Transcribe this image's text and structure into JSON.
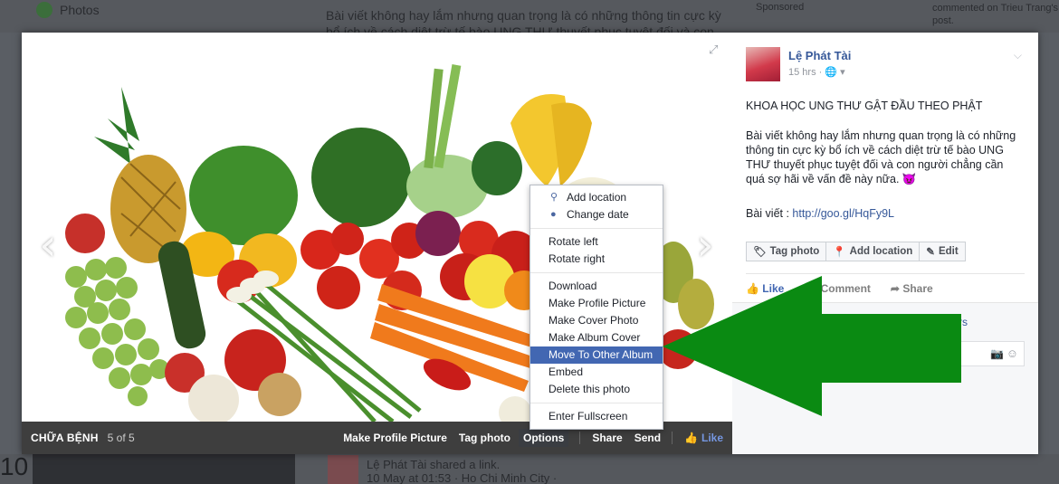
{
  "background": {
    "sidebar_label": "Photos",
    "post_text": "Bài viết không hay lắm nhưng quan trọng là có những thông tin cực kỳ bổ ích về cách diệt trừ tế bào UNG THƯ thuyết phục tuyệt đối và con người",
    "sponsored": "Sponsored",
    "notification": "commented on Trieu Trang's post.",
    "bottom_number": "10",
    "shared_author": "Lệ Phát Tài",
    "shared_action": "shared a link.",
    "shared_meta": "10 May at 01:53 · Ho Chi Minh City ·"
  },
  "photo_bar": {
    "album_title": "CHỮA BỆNH",
    "count": "5 of 5",
    "make_profile": "Make Profile Picture",
    "tag_photo": "Tag photo",
    "options": "Options",
    "share": "Share",
    "send": "Send",
    "like": "Like"
  },
  "options_menu": {
    "group1": [
      "Add location",
      "Change date"
    ],
    "group2": [
      "Rotate left",
      "Rotate right"
    ],
    "group3": [
      "Download",
      "Make Profile Picture",
      "Make Cover Photo",
      "Make Album Cover",
      "Move To Other Album",
      "Embed",
      "Delete this photo"
    ],
    "group4": [
      "Enter Fullscreen"
    ],
    "highlighted": "Move To Other Album"
  },
  "post": {
    "author": "Lệ Phát Tài",
    "time": "15 hrs ·",
    "title": "KHOA HỌC UNG THƯ GẬT ĐẦU THEO PHẬT",
    "body": "Bài viết không hay lắm nhưng quan trọng là có những thông tin cực kỳ bổ ích về cách diệt trừ tế bào UNG THƯ thuyết phục tuyệt đối và con người chẳng cần quá sợ hãi về vấn đề này nữa. 😈",
    "link_label": "Bài viết :",
    "link_url": "http://goo.gl/HqFy9L",
    "buttons": {
      "tag_photo": "Tag photo",
      "add_location": "Add location",
      "edit": "Edit"
    },
    "actions": {
      "like": "Like",
      "comment": "Comment",
      "share": "Share"
    },
    "fragment": "rs"
  },
  "colors": {
    "accent": "#4267b2",
    "arrow": "#0a8a12",
    "link": "#365899"
  }
}
